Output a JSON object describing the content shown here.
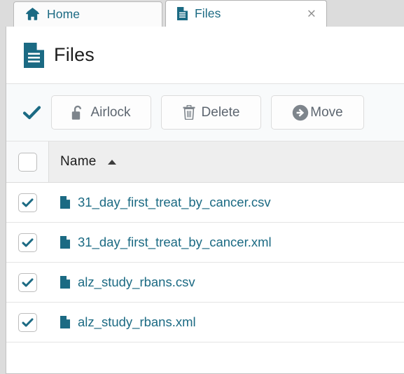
{
  "theme": {
    "accent": "#1b6a83",
    "link": "#1b6a83",
    "icon_grey": "#7e858c",
    "text_dark": "#1c1c1c",
    "button_text": "#5d6670",
    "page_bg": "#dcdcdc",
    "toolbar_bg": "#f8fafb",
    "table_header_bg": "#eeeeee"
  },
  "tabs": [
    {
      "label": "Home",
      "icon": "home-icon",
      "active": false,
      "closable": false
    },
    {
      "label": "Files",
      "icon": "file-icon",
      "active": true,
      "closable": true,
      "close_label": "×"
    }
  ],
  "header": {
    "title": "Files",
    "icon": "document-lines-icon"
  },
  "toolbar": {
    "select_indicator_icon": "check-icon",
    "buttons": [
      {
        "label": "Airlock",
        "icon": "unlock-icon"
      },
      {
        "label": "Delete",
        "icon": "trash-icon"
      },
      {
        "label": "Move",
        "icon": "arrow-circle-right-icon"
      }
    ]
  },
  "table": {
    "columns": [
      {
        "key": "select",
        "label": "",
        "checked": false
      },
      {
        "key": "name",
        "label": "Name",
        "sort": "asc",
        "sort_icon": "caret-up-icon"
      }
    ],
    "rows": [
      {
        "name": "31_day_first_treat_by_cancer.csv",
        "checked": true,
        "icon": "file-icon"
      },
      {
        "name": "31_day_first_treat_by_cancer.xml",
        "checked": true,
        "icon": "file-icon"
      },
      {
        "name": "alz_study_rbans.csv",
        "checked": true,
        "icon": "file-icon"
      },
      {
        "name": "alz_study_rbans.xml",
        "checked": true,
        "icon": "file-icon"
      }
    ]
  }
}
